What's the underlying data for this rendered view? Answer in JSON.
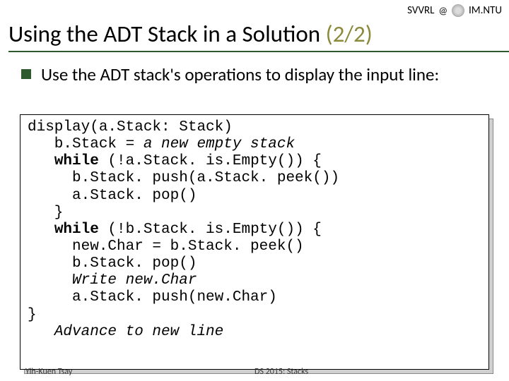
{
  "header": {
    "left": "SVVRL",
    "at": "@",
    "right": "IM.NTU"
  },
  "title": {
    "main": "Using the ADT Stack in a Solution ",
    "paren": "(2/2)"
  },
  "bullet": "Use the ADT stack's operations to display the input line:",
  "code": {
    "l1a": "display(a.Stack: Stack)",
    "l2a": "   b.Stack = ",
    "l2b": "a new empty stack",
    "l3a": "   ",
    "l3b": "while",
    "l3c": " (!a.Stack. is.Empty()) {",
    "l4a": "     b.Stack. push(a.Stack. peek())",
    "l5a": "     a.Stack. pop()",
    "l6a": "   }",
    "l7a": "   ",
    "l7b": "while",
    "l7c": " (!b.Stack. is.Empty()) {",
    "l8a": "     new.Char = b.Stack. peek()",
    "l9a": "     b.Stack. pop()",
    "l10a": "     ",
    "l10b": "Write new.Char",
    "l11a": "     a.Stack. push(new.Char)",
    "l12a": "}",
    "l13a": "   ",
    "l13b": "Advance to new line"
  },
  "footer": {
    "left": "Yih-Kuen Tsay",
    "center": "DS 2015: Stacks"
  }
}
